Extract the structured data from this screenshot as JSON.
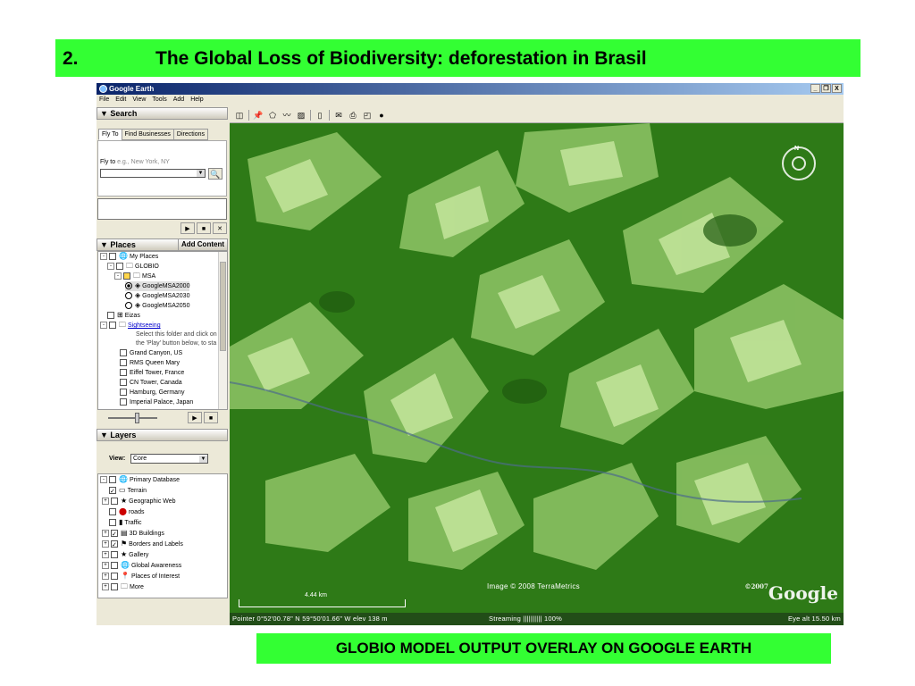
{
  "slide": {
    "number": "2.",
    "title": "The Global Loss of Biodiversity: deforestation in Brasil",
    "caption": "GLOBIO MODEL OUTPUT OVERLAY ON GOOGLE EARTH"
  },
  "window": {
    "title": "Google Earth",
    "buttons": [
      "_",
      "❐",
      "X"
    ],
    "menu": [
      "File",
      "Edit",
      "View",
      "Tools",
      "Add",
      "Help"
    ]
  },
  "search": {
    "header": "▼ Search",
    "tabs": [
      "Fly To",
      "Find Businesses",
      "Directions"
    ],
    "fly_label": "Fly to",
    "fly_placeholder": "e.g., New York, NY",
    "search_icon": "🔍",
    "controls": [
      "▶",
      "■",
      "✕"
    ]
  },
  "places": {
    "header": "▼ Places",
    "add_content": "Add Content",
    "items": [
      {
        "label": "My Places"
      },
      {
        "label": "GLOBIO"
      },
      {
        "label": "MSA"
      },
      {
        "label": "GoogleMSA2000"
      },
      {
        "label": "GoogleMSA2030"
      },
      {
        "label": "GoogleMSA2050"
      },
      {
        "label": "Eizas"
      },
      {
        "label": "Sightseeing"
      },
      {
        "label": "Select this folder and click on"
      },
      {
        "label": "the 'Play' button below, to sta"
      },
      {
        "label": "Grand Canyon, US"
      },
      {
        "label": "RMS Queen Mary"
      },
      {
        "label": "Eiffel Tower, France"
      },
      {
        "label": "CN Tower, Canada"
      },
      {
        "label": "Hamburg, Germany"
      },
      {
        "label": "Imperial Palace, Japan"
      }
    ],
    "controls": [
      "▶",
      "■"
    ]
  },
  "layers": {
    "header": "▼ Layers",
    "view_label": "View:",
    "view_value": "Core",
    "items": [
      {
        "label": "Primary Database"
      },
      {
        "label": "Terrain"
      },
      {
        "label": "Geographic Web"
      },
      {
        "label": "roads"
      },
      {
        "label": "Traffic"
      },
      {
        "label": "3D Buildings"
      },
      {
        "label": "Borders and Labels"
      },
      {
        "label": "Gallery"
      },
      {
        "label": "Global Awareness"
      },
      {
        "label": "Places of Interest"
      },
      {
        "label": "More"
      }
    ]
  },
  "map": {
    "compass_n": "N",
    "copyright": "Image © 2008 TerraMetrics",
    "logo": "Google",
    "logo_prefix": "©2007",
    "scale": "4.44 km",
    "status": {
      "pointer": "Pointer  0°52'00.78\" N    59°50'01.66\" W   elev  138 m",
      "streaming": "Streaming  |||||||||| 100%",
      "eye": "Eye alt   15.50 km"
    }
  },
  "colors": {
    "slide_green": "#33ff33",
    "forest": "#2f7718",
    "cleared": "#a6cc7a"
  }
}
